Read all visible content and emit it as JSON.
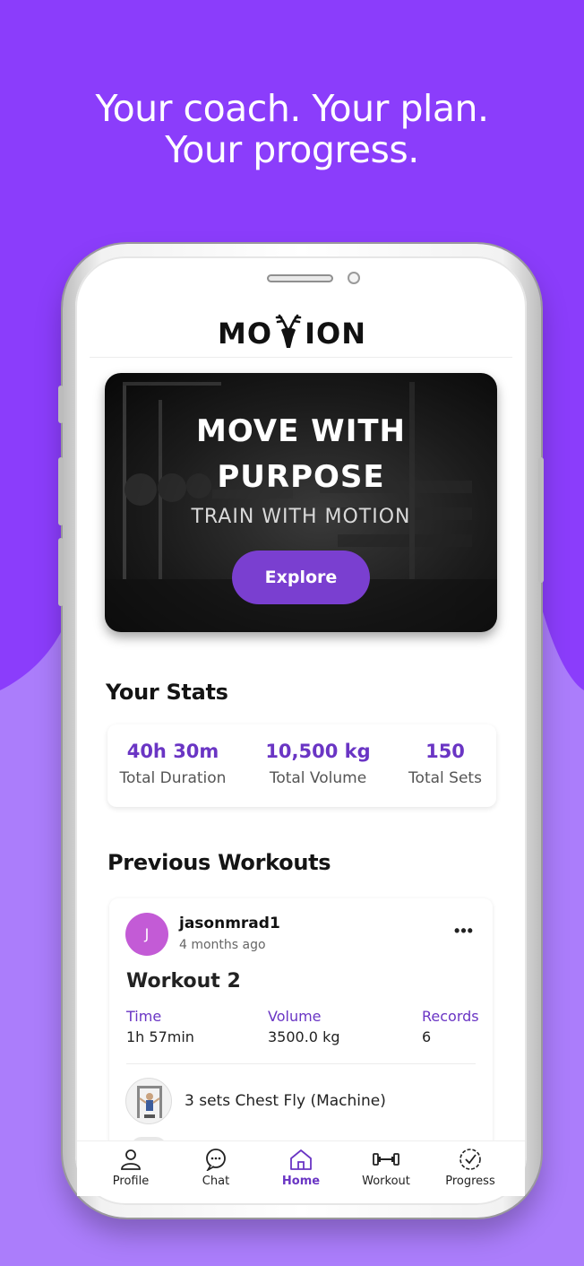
{
  "headline": {
    "line1": "Your coach. Your plan.",
    "line2": "Your progress."
  },
  "app": {
    "logo_left": "MO",
    "logo_right": "ION"
  },
  "hero": {
    "title_line1": "MOVE WITH",
    "title_line2": "PURPOSE",
    "subtitle": "TRAIN WITH MOTION",
    "button_label": "Explore"
  },
  "stats": {
    "title": "Your Stats",
    "items": [
      {
        "value": "40h 30m",
        "label": "Total Duration"
      },
      {
        "value": "10,500 kg",
        "label": "Total Volume"
      },
      {
        "value": "150",
        "label": "Total Sets"
      }
    ]
  },
  "previous_workouts": {
    "title": "Previous Workouts",
    "card": {
      "avatar_initial": "J",
      "username": "jasonmrad1",
      "time_ago": "4 months ago",
      "more_label": "•••",
      "workout_title": "Workout 2",
      "metrics": [
        {
          "label": "Time",
          "value": "1h 57min"
        },
        {
          "label": "Volume",
          "value": "3500.0 kg"
        },
        {
          "label": "Records",
          "value": "6"
        }
      ],
      "exercise": "3 sets Chest Fly (Machine)"
    }
  },
  "nav": {
    "items": [
      {
        "label": "Profile",
        "icon": "person-icon"
      },
      {
        "label": "Chat",
        "icon": "chat-bubble-icon"
      },
      {
        "label": "Home",
        "icon": "home-icon",
        "active": true
      },
      {
        "label": "Workout",
        "icon": "dumbbell-icon"
      },
      {
        "label": "Progress",
        "icon": "check-circle-icon"
      }
    ]
  },
  "colors": {
    "background_top": "#8b3dfb",
    "background_bottom": "#ab7dfb",
    "accent": "#6a35c4",
    "button": "#7a3fd0",
    "avatar": "#c35bd6"
  }
}
